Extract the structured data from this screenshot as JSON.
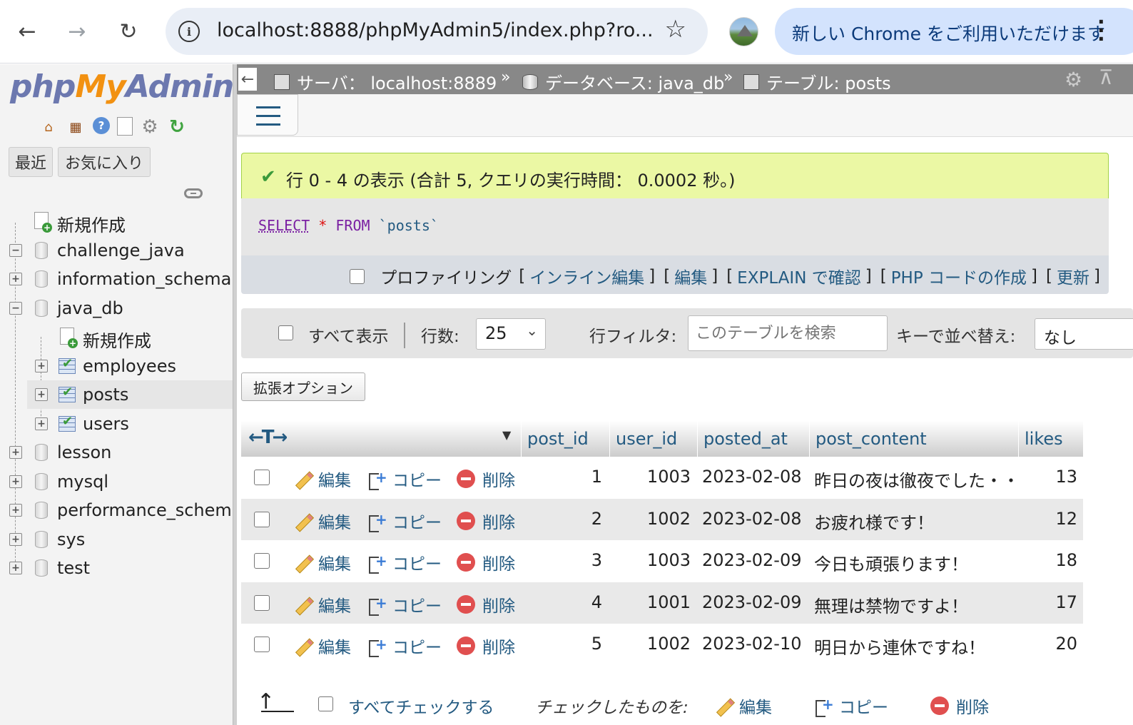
{
  "browser": {
    "url": "localhost:8888/phpMyAdmin5/index.php?ro...",
    "update_label": "新しい Chrome をご利用いただけます",
    "back_icon": "←",
    "forward_icon": "→",
    "reload_icon": "↻",
    "star_icon": "☆",
    "menu_icon": "⋮"
  },
  "nav": {
    "logo_php": "php",
    "logo_my": "My",
    "logo_admin": "Admin",
    "tabs": {
      "recent": "最近",
      "favorites": "お気に入り"
    },
    "tree": [
      {
        "label": "新規作成",
        "level": 0,
        "kind": "new"
      },
      {
        "label": "challenge_java",
        "level": 0,
        "kind": "db",
        "expander": "−"
      },
      {
        "label": "information_schema",
        "level": 0,
        "kind": "db",
        "expander": "+"
      },
      {
        "label": "java_db",
        "level": 0,
        "kind": "db",
        "expander": "−"
      },
      {
        "label": "新規作成",
        "level": 1,
        "kind": "new"
      },
      {
        "label": "employees",
        "level": 1,
        "kind": "table",
        "expander": "+"
      },
      {
        "label": "posts",
        "level": 1,
        "kind": "table",
        "expander": "+",
        "selected": true
      },
      {
        "label": "users",
        "level": 1,
        "kind": "table",
        "expander": "+"
      },
      {
        "label": "lesson",
        "level": 0,
        "kind": "db",
        "expander": "+"
      },
      {
        "label": "mysql",
        "level": 0,
        "kind": "db",
        "expander": "+"
      },
      {
        "label": "performance_schema",
        "level": 0,
        "kind": "db",
        "expander": "+"
      },
      {
        "label": "sys",
        "level": 0,
        "kind": "db",
        "expander": "+"
      },
      {
        "label": "test",
        "level": 0,
        "kind": "db",
        "expander": "+"
      }
    ]
  },
  "breadcrumb": {
    "back": "←",
    "server": "サーバ： localhost:8889",
    "database": "データベース: java_db",
    "table": "テーブル: posts",
    "separator": "»"
  },
  "message": {
    "success": "行 0 - 4 の表示 (合計 5, クエリの実行時間： 0.0002 秒。)"
  },
  "sql": {
    "select": "SELECT",
    "star": "*",
    "from": "FROM",
    "table": "`posts`"
  },
  "profiling": {
    "label": "プロファイリング",
    "links": [
      "インライン編集",
      "編集",
      "EXPLAIN で確認",
      "PHP コードの作成",
      "更新"
    ]
  },
  "filters": {
    "show_all": "すべて表示",
    "rows_label": "行数:",
    "rows_value": "25",
    "filter_label": "行フィルタ:",
    "filter_placeholder": "このテーブルを検索",
    "sort_label": "キーで並べ替え:",
    "sort_value": "なし"
  },
  "options_button": "拡張オプション",
  "table": {
    "columns": [
      "post_id",
      "user_id",
      "posted_at",
      "post_content",
      "likes"
    ],
    "actions": {
      "edit": "編集",
      "copy": "コピー",
      "delete": "削除"
    },
    "rows": [
      {
        "post_id": "1",
        "user_id": "1003",
        "posted_at": "2023-02-08",
        "post_content": "昨日の夜は徹夜でした・・",
        "likes": "13"
      },
      {
        "post_id": "2",
        "user_id": "1002",
        "posted_at": "2023-02-08",
        "post_content": "お疲れ様です！",
        "likes": "12"
      },
      {
        "post_id": "3",
        "user_id": "1003",
        "posted_at": "2023-02-09",
        "post_content": "今日も頑張ります！",
        "likes": "18"
      },
      {
        "post_id": "4",
        "user_id": "1001",
        "posted_at": "2023-02-09",
        "post_content": "無理は禁物ですよ！",
        "likes": "17"
      },
      {
        "post_id": "5",
        "user_id": "1002",
        "posted_at": "2023-02-10",
        "post_content": "明日から連休ですね！",
        "likes": "20"
      }
    ]
  },
  "footer": {
    "check_all": "すべてチェックする",
    "with_selected": "チェックしたものを:",
    "edit": "編集",
    "copy": "コピー",
    "delete": "削除"
  },
  "colors": {
    "link": "#235a81",
    "success_bg": "#ebf8a4",
    "logo_blue": "#6c78af",
    "logo_orange": "#f29111"
  }
}
